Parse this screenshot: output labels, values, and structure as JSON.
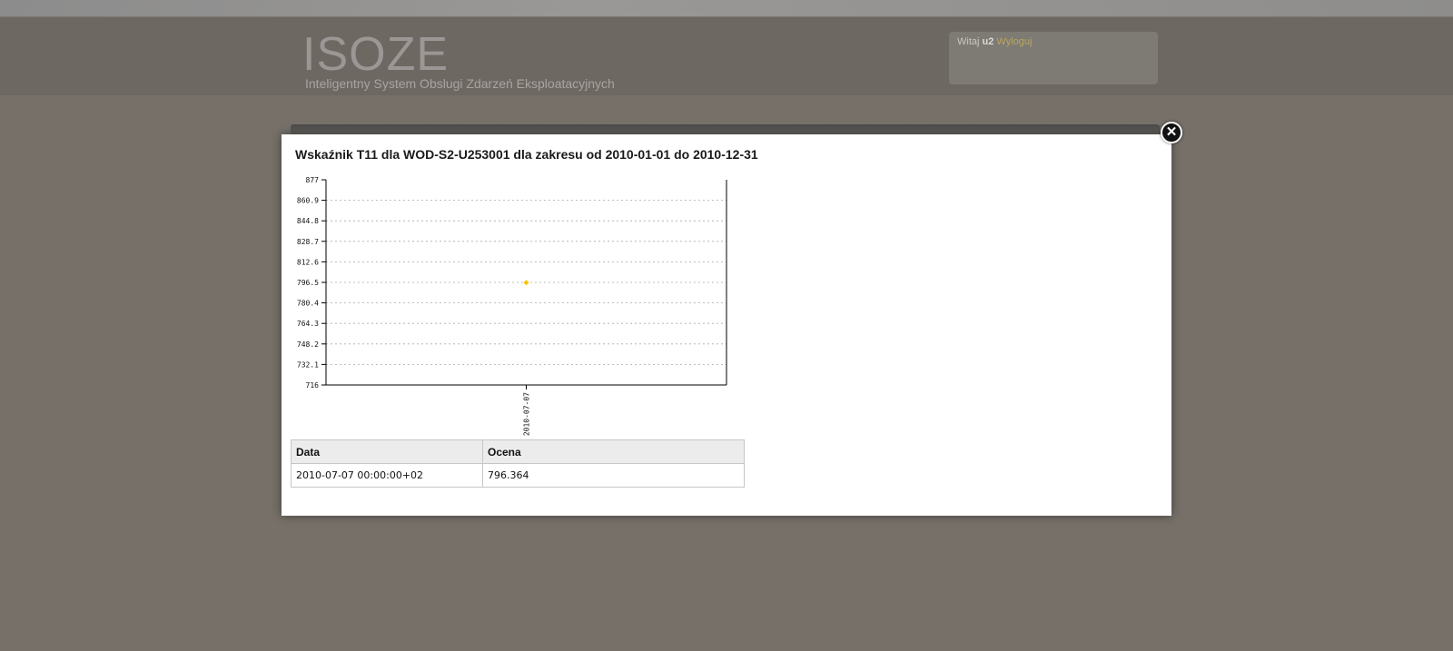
{
  "header": {
    "logo_title": "ISOZE",
    "logo_subtitle": "Inteligentny System Obslugi Zdarzeń Eksploatacyjnych"
  },
  "user_box": {
    "greeting": "Witaj",
    "username": "u2",
    "logout_label": "Wyloguj"
  },
  "modal": {
    "close_glyph": "✕",
    "title": "Wskaźnik T11 dla WOD-S2-U253001 dla zakresu od 2010-01-01 do 2010-12-31"
  },
  "chart_data": {
    "type": "scatter",
    "title": "",
    "xlabel": "",
    "ylabel": "",
    "ylim": [
      716,
      877
    ],
    "y_ticks": [
      "877",
      "860.9",
      "844.8",
      "828.7",
      "812.6",
      "796.5",
      "780.4",
      "764.3",
      "748.2",
      "732.1",
      "716"
    ],
    "x_ticks": [
      "2010-07-07"
    ],
    "points": [
      {
        "x": "2010-07-07",
        "y": 796.364
      }
    ],
    "grid": true,
    "point_color": "#f5c400"
  },
  "table": {
    "headers": [
      "Data",
      "Ocena"
    ],
    "rows": [
      [
        "2010-07-07 00:00:00+02",
        "796.364"
      ]
    ]
  }
}
